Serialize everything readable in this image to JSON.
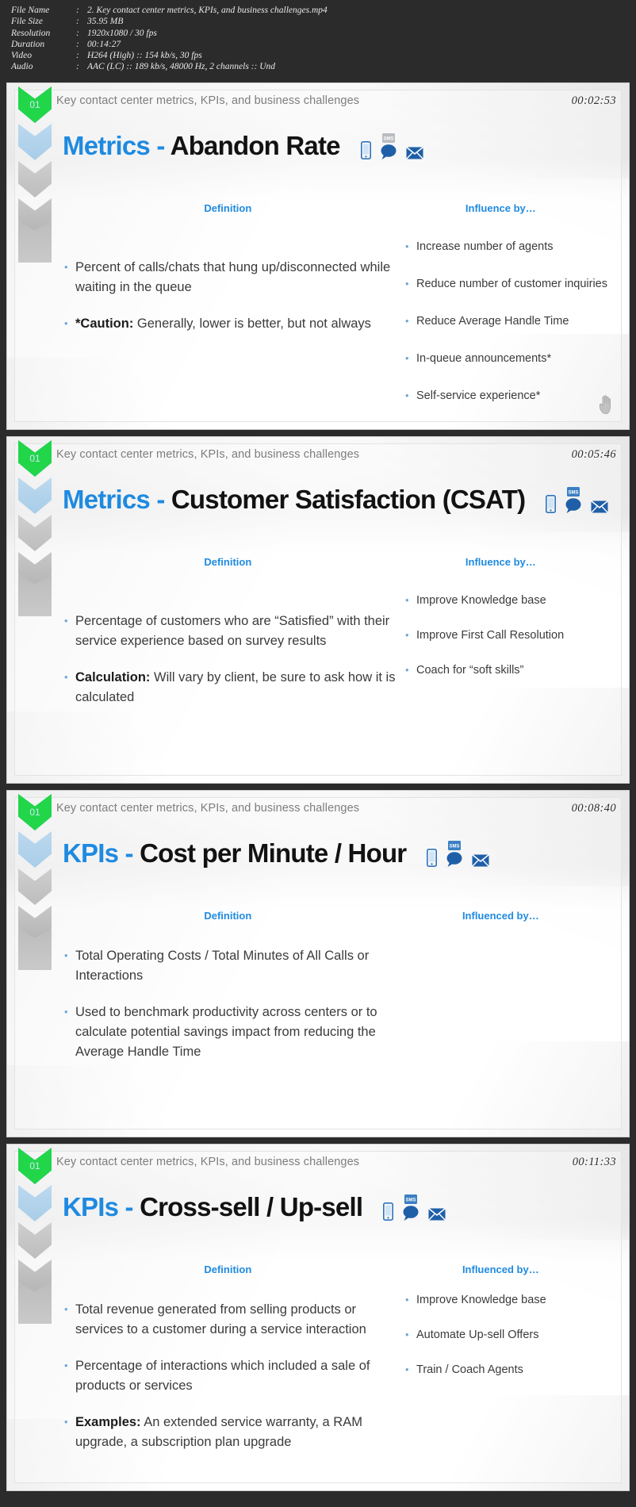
{
  "file_info": {
    "rows": [
      {
        "key": "File Name",
        "value": "2. Key contact center metrics, KPIs, and business challenges.mp4"
      },
      {
        "key": "File Size",
        "value": "35.95 MB"
      },
      {
        "key": "Resolution",
        "value": "1920x1080 / 30 fps"
      },
      {
        "key": "Duration",
        "value": "00:14:27"
      },
      {
        "key": "Video",
        "value": "H264 (High) :: 154 kb/s, 30 fps"
      },
      {
        "key": "Audio",
        "value": "AAC (LC) :: 189 kb/s, 48000 Hz, 2 channels :: Und"
      }
    ],
    "separator": ":"
  },
  "colors": {
    "accent_blue": "#1f8ae0",
    "bullet_blue": "#6fa8d8",
    "chevron_green": "#22d64a",
    "icon_blue": "#1f5fa8",
    "background": "#2b2b2b"
  },
  "deck": {
    "title": "Key contact center metrics, KPIs, and business challenges",
    "chevron_number": "01",
    "icons": [
      "mobile-phone-icon",
      "sms-chat-bubble-icon",
      "envelope-icon"
    ]
  },
  "slides": [
    {
      "timestamp": "00:02:53",
      "title_accent": "Metrics",
      "title_dash": " - ",
      "title_rest": "Abandon Rate",
      "left_heading": "Definition",
      "right_heading": "Influence by…",
      "left_bullets": [
        {
          "bold": "",
          "text": "Percent of calls/chats that hung up/disconnected while waiting in the queue"
        },
        {
          "bold": "*Caution:",
          "text": " Generally, lower is better, but not always"
        }
      ],
      "right_bullets": [
        "Increase number of agents",
        "Reduce number of customer inquiries",
        "Reduce Average Handle Time",
        "In-queue announcements*",
        "Self-service experience*"
      ],
      "has_cursor": true
    },
    {
      "timestamp": "00:05:46",
      "title_accent": "Metrics",
      "title_dash": " - ",
      "title_rest": "Customer Satisfaction (CSAT)",
      "left_heading": "Definition",
      "right_heading": "Influence by…",
      "left_bullets": [
        {
          "bold": "",
          "text": "Percentage of customers who are “Satisfied” with their service experience based on survey results"
        },
        {
          "bold": "Calculation:",
          "text": " Will vary by client, be sure to ask how it is calculated"
        }
      ],
      "right_bullets": [
        "Improve Knowledge base",
        "Improve First Call Resolution",
        "Coach for “soft skills”"
      ],
      "has_cursor": false
    },
    {
      "timestamp": "00:08:40",
      "title_accent": "KPIs",
      "title_dash": " - ",
      "title_rest": "Cost per Minute / Hour",
      "left_heading": "Definition",
      "right_heading": "Influenced by…",
      "left_bullets": [
        {
          "bold": "",
          "text": "Total Operating Costs / Total Minutes of All Calls or Interactions"
        },
        {
          "bold": "",
          "text": "Used to benchmark productivity across centers or to calculate potential savings impact from reducing the Average Handle Time"
        }
      ],
      "right_bullets": [],
      "has_cursor": false
    },
    {
      "timestamp": "00:11:33",
      "title_accent": "KPIs",
      "title_dash": " - ",
      "title_rest": "Cross-sell / Up-sell",
      "left_heading": "Definition",
      "right_heading": "Influenced by…",
      "left_bullets": [
        {
          "bold": "",
          "text": "Total revenue generated from selling products or services to a customer during a service interaction"
        },
        {
          "bold": "",
          "text": "Percentage of interactions which included a sale of products or services"
        },
        {
          "bold": "Examples:",
          "text": " An extended service warranty, a RAM upgrade, a subscription plan upgrade"
        }
      ],
      "right_bullets": [
        "Improve Knowledge base",
        "Automate Up-sell Offers",
        "Train / Coach Agents"
      ],
      "has_cursor": false
    }
  ]
}
